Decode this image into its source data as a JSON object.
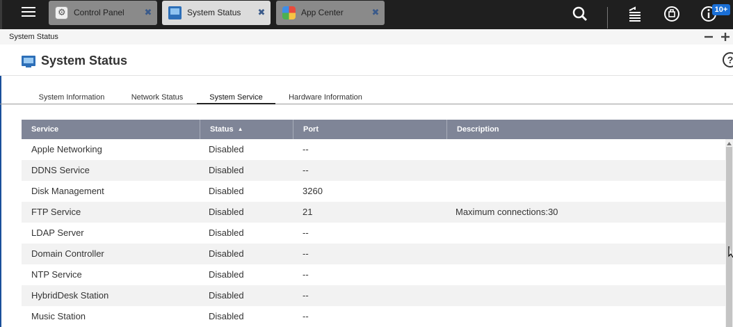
{
  "taskbar": {
    "tabs": [
      {
        "label": "Control Panel",
        "icon": "control-panel-icon",
        "state": "inactive"
      },
      {
        "label": "System Status",
        "icon": "system-status-icon",
        "state": "active"
      },
      {
        "label": "App Center",
        "icon": "app-center-icon",
        "state": "inactive"
      }
    ],
    "close_glyph": "✖",
    "notification_badge": "10+"
  },
  "window": {
    "title": "System Status"
  },
  "page": {
    "title": "System Status",
    "help_glyph": "?"
  },
  "subtabs": [
    {
      "label": "System Information",
      "active": false
    },
    {
      "label": "Network Status",
      "active": false
    },
    {
      "label": "System Service",
      "active": true
    },
    {
      "label": "Hardware Information",
      "active": false
    }
  ],
  "table": {
    "columns": [
      "Service",
      "Status",
      "Port",
      "Description"
    ],
    "sort_indicator": "▲",
    "rows": [
      {
        "service": "Apple Networking",
        "status": "Disabled",
        "port": "--",
        "description": ""
      },
      {
        "service": "DDNS Service",
        "status": "Disabled",
        "port": "--",
        "description": ""
      },
      {
        "service": "Disk Management",
        "status": "Disabled",
        "port": "3260",
        "description": ""
      },
      {
        "service": "FTP Service",
        "status": "Disabled",
        "port": "21",
        "description": "Maximum connections:30"
      },
      {
        "service": "LDAP Server",
        "status": "Disabled",
        "port": "--",
        "description": ""
      },
      {
        "service": "Domain Controller",
        "status": "Disabled",
        "port": "--",
        "description": ""
      },
      {
        "service": "NTP Service",
        "status": "Disabled",
        "port": "--",
        "description": ""
      },
      {
        "service": "HybridDesk Station",
        "status": "Disabled",
        "port": "--",
        "description": ""
      },
      {
        "service": "Music Station",
        "status": "Disabled",
        "port": "--",
        "description": ""
      }
    ]
  },
  "colors": {
    "taskbar_bg": "#1f1f1f",
    "table_header_bg": "#7f8597",
    "accent_blue": "#2d6fb8",
    "badge_blue": "#1a6fd6"
  }
}
